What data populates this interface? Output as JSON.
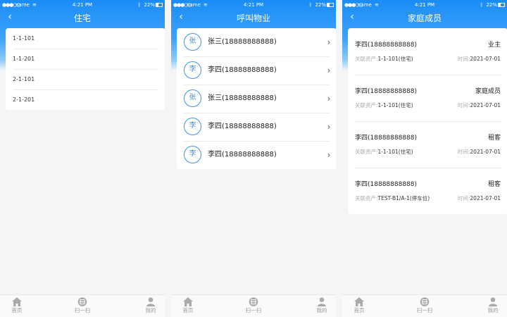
{
  "status": {
    "carrier": "name",
    "time": "4:21 PM",
    "battery": "22%"
  },
  "screens": [
    {
      "title": "住宅",
      "items": [
        "1-1-101",
        "1-1-201",
        "2-1-101",
        "2-1-201"
      ]
    },
    {
      "title": "呼叫物业",
      "contacts": [
        {
          "avatar": "张",
          "name": "张三(18888888888)"
        },
        {
          "avatar": "李",
          "name": "李四(18888888888)"
        },
        {
          "avatar": "张",
          "name": "张三(18888888888)"
        },
        {
          "avatar": "李",
          "name": "李四(18888888888)"
        },
        {
          "avatar": "李",
          "name": "李四(18888888888)"
        }
      ]
    },
    {
      "title": "家庭成员",
      "asset_label": "关联资产:",
      "time_label": "时间:",
      "members": [
        {
          "name": "李四(18888888888)",
          "role": "业主",
          "asset": "1-1-101(住宅)",
          "time": "2021-07-01"
        },
        {
          "name": "李四(18888888888)",
          "role": "家庭成员",
          "asset": "1-1-101(住宅)",
          "time": "2021-07-01"
        },
        {
          "name": "李四(18888888888)",
          "role": "租客",
          "asset": "1-1-101(住宅)",
          "time": "2021-07-01"
        },
        {
          "name": "李四(18888888888)",
          "role": "租客",
          "asset": "TEST-B1/A-1(停车位)",
          "time": "2021-07-01"
        }
      ]
    }
  ],
  "tabbar": {
    "home": "首页",
    "scan": "扫一扫",
    "mine": "我的"
  },
  "colors": {
    "accent": "#1a8cf8",
    "avatar_ring": "#3a94f7"
  }
}
